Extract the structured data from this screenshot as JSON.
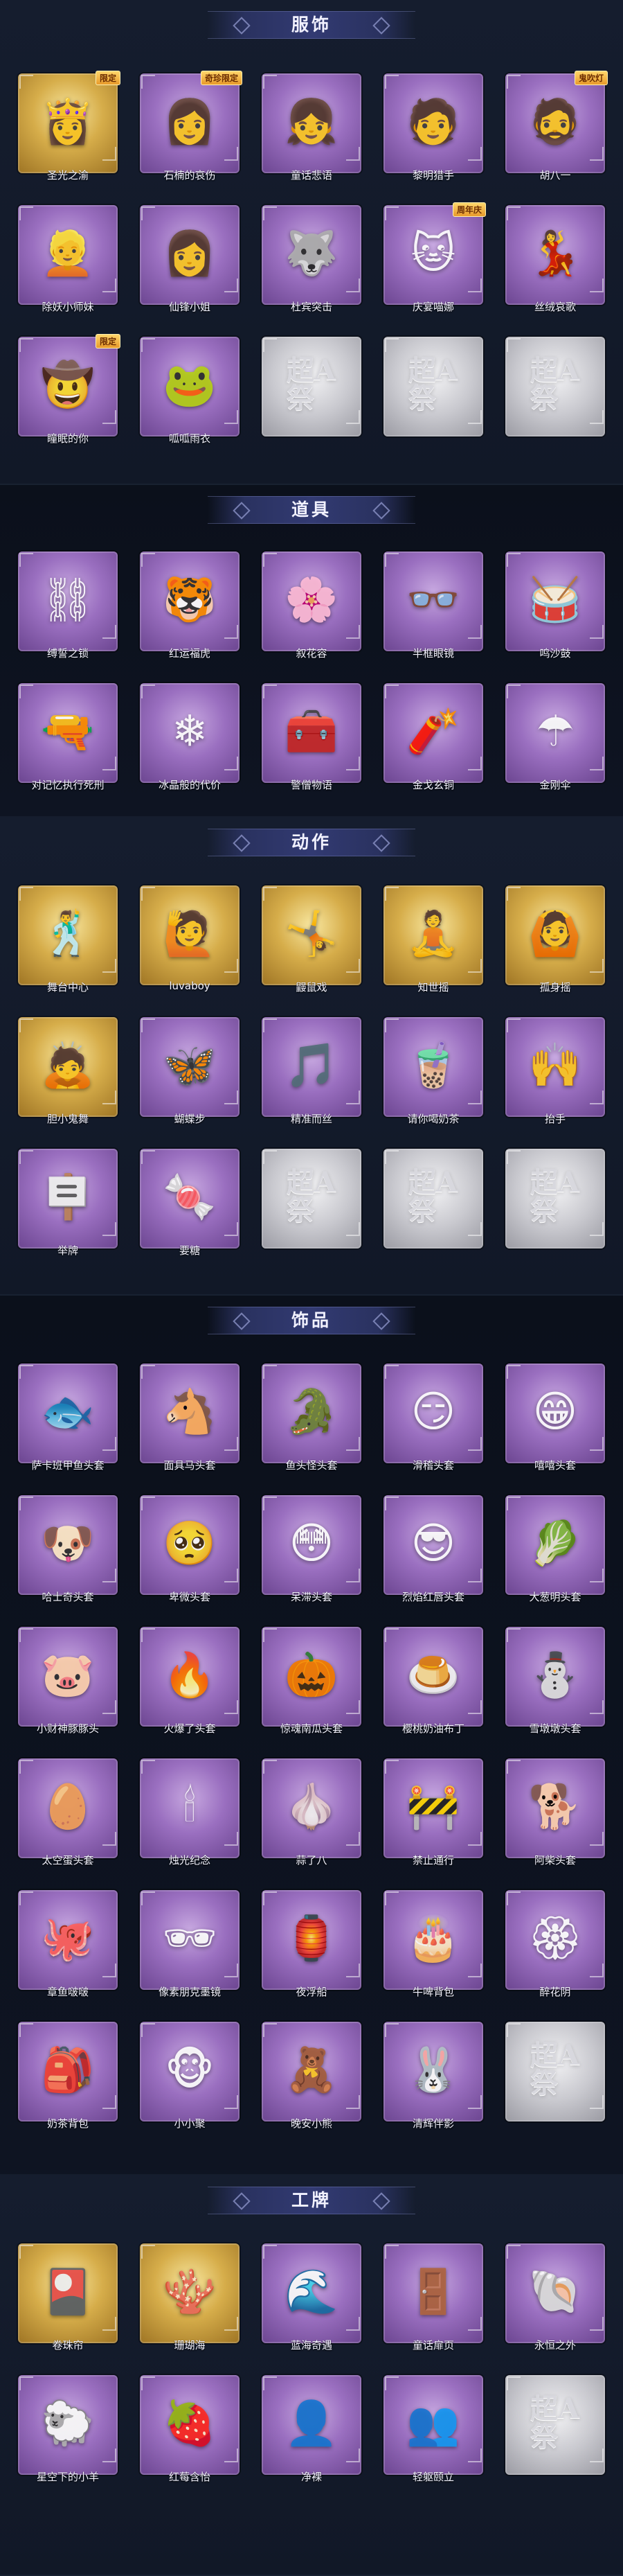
{
  "sections": [
    {
      "title": "服饰",
      "items": [
        {
          "name": "圣光之渝",
          "rarity": "gold",
          "icon": "blonde-girl-portrait",
          "glyph": "👸",
          "badge": "限定"
        },
        {
          "name": "石楠的哀伤",
          "rarity": "purple",
          "icon": "silver-hair-girl-portrait",
          "glyph": "👩",
          "badge": "奇珍限定"
        },
        {
          "name": "童话悲语",
          "rarity": "purple",
          "icon": "red-hair-girl-portrait",
          "glyph": "👧",
          "badge": ""
        },
        {
          "name": "黎明猎手",
          "rarity": "purple",
          "icon": "hunter-portrait",
          "glyph": "🧑",
          "badge": ""
        },
        {
          "name": "胡八一",
          "rarity": "purple",
          "icon": "explorer-portrait",
          "glyph": "🧔",
          "badge": "鬼吹灯"
        },
        {
          "name": "除妖小师妹",
          "rarity": "purple",
          "icon": "exorcist-girl-portrait",
          "glyph": "👱",
          "badge": ""
        },
        {
          "name": "仙锋小姐",
          "rarity": "purple",
          "icon": "lady-portrait",
          "glyph": "👩",
          "badge": ""
        },
        {
          "name": "杜宾突击",
          "rarity": "purple",
          "icon": "doberman-girl-portrait",
          "glyph": "🐺",
          "badge": ""
        },
        {
          "name": "庆宴喵娜",
          "rarity": "purple",
          "icon": "cat-girl-portrait",
          "glyph": "🐱",
          "badge": "周年庆"
        },
        {
          "name": "丝绒哀歌",
          "rarity": "purple",
          "icon": "velvet-girl-portrait",
          "glyph": "💃",
          "badge": ""
        },
        {
          "name": "瞳眠的你",
          "rarity": "purple",
          "icon": "witch-hat-girl-portrait",
          "glyph": "🤠",
          "badge": "限定"
        },
        {
          "name": "呱呱雨衣",
          "rarity": "purple",
          "icon": "frog-raincoat-portrait",
          "glyph": "🐸",
          "badge": ""
        },
        {
          "name": "",
          "rarity": "silver",
          "icon": "placeholder-logo",
          "glyph": "超A祭",
          "badge": ""
        },
        {
          "name": "",
          "rarity": "silver",
          "icon": "placeholder-logo",
          "glyph": "超A祭",
          "badge": ""
        },
        {
          "name": "",
          "rarity": "silver",
          "icon": "placeholder-logo",
          "glyph": "超A祭",
          "badge": ""
        }
      ]
    },
    {
      "title": "道具",
      "items": [
        {
          "name": "缚誓之锁",
          "rarity": "purple",
          "icon": "chain-lock-icon",
          "glyph": "⛓",
          "badge": ""
        },
        {
          "name": "红运福虎",
          "rarity": "purple",
          "icon": "tiger-icon",
          "glyph": "🐯",
          "badge": ""
        },
        {
          "name": "叙花容",
          "rarity": "purple",
          "icon": "flower-vine-icon",
          "glyph": "🌸",
          "badge": ""
        },
        {
          "name": "半框眼镜",
          "rarity": "purple",
          "icon": "glasses-icon",
          "glyph": "👓",
          "badge": ""
        },
        {
          "name": "鸣沙鼓",
          "rarity": "purple",
          "icon": "drum-icon",
          "glyph": "🥁",
          "badge": ""
        },
        {
          "name": "对记忆执行死刑",
          "rarity": "purple",
          "icon": "gun-icon",
          "glyph": "🔫",
          "badge": ""
        },
        {
          "name": "冰晶般的代价",
          "rarity": "purple",
          "icon": "ice-flower-icon",
          "glyph": "❄",
          "badge": ""
        },
        {
          "name": "警僧物语",
          "rarity": "purple",
          "icon": "medkit-icon",
          "glyph": "🧰",
          "badge": ""
        },
        {
          "name": "金戈玄铜",
          "rarity": "purple",
          "icon": "bronze-grenade-icon",
          "glyph": "🧨",
          "badge": ""
        },
        {
          "name": "金刚伞",
          "rarity": "purple",
          "icon": "umbrella-icon",
          "glyph": "☂",
          "badge": ""
        }
      ]
    },
    {
      "title": "动作",
      "items": [
        {
          "name": "舞台中心",
          "rarity": "gold",
          "icon": "pose-figure-icon",
          "glyph": "🕺",
          "badge": ""
        },
        {
          "name": "luvaboy",
          "rarity": "gold",
          "icon": "pose-figure-icon",
          "glyph": "🙋",
          "badge": ""
        },
        {
          "name": "鼹鼠戏",
          "rarity": "gold",
          "icon": "pose-figure-icon",
          "glyph": "🤸",
          "badge": ""
        },
        {
          "name": "知世摇",
          "rarity": "gold",
          "icon": "pose-figure-icon",
          "glyph": "🧘",
          "badge": ""
        },
        {
          "name": "孤身摇",
          "rarity": "gold",
          "icon": "pose-figure-icon",
          "glyph": "🙆",
          "badge": ""
        },
        {
          "name": "胆小鬼舞",
          "rarity": "gold",
          "icon": "pose-figure-icon",
          "glyph": "🙇",
          "badge": ""
        },
        {
          "name": "蝴蝶步",
          "rarity": "purple",
          "icon": "pose-figure-icon",
          "glyph": "🦋",
          "badge": ""
        },
        {
          "name": "精准而丝",
          "rarity": "purple",
          "icon": "pose-figure-icon",
          "glyph": "🎵",
          "badge": ""
        },
        {
          "name": "请你喝奶茶",
          "rarity": "purple",
          "icon": "pose-figure-icon",
          "glyph": "🧋",
          "badge": ""
        },
        {
          "name": "抬手",
          "rarity": "purple",
          "icon": "pose-figure-icon",
          "glyph": "🙌",
          "badge": ""
        },
        {
          "name": "举牌",
          "rarity": "purple",
          "icon": "pose-figure-icon",
          "glyph": "🪧",
          "badge": ""
        },
        {
          "name": "要糖",
          "rarity": "purple",
          "icon": "pose-figure-icon",
          "glyph": "🍬",
          "badge": ""
        },
        {
          "name": "",
          "rarity": "silver",
          "icon": "placeholder-logo",
          "glyph": "超A祭",
          "badge": ""
        },
        {
          "name": "",
          "rarity": "silver",
          "icon": "placeholder-logo",
          "glyph": "超A祭",
          "badge": ""
        },
        {
          "name": "",
          "rarity": "silver",
          "icon": "placeholder-logo",
          "glyph": "超A祭",
          "badge": ""
        }
      ]
    },
    {
      "title": "饰品",
      "items": [
        {
          "name": "萨卡班甲鱼头套",
          "rarity": "purple",
          "icon": "fish-head-icon",
          "glyph": "🐟",
          "badge": ""
        },
        {
          "name": "面具马头套",
          "rarity": "purple",
          "icon": "horse-head-icon",
          "glyph": "🐴",
          "badge": ""
        },
        {
          "name": "鱼头怪头套",
          "rarity": "purple",
          "icon": "fish-monster-icon",
          "glyph": "🐊",
          "badge": ""
        },
        {
          "name": "滑稽头套",
          "rarity": "purple",
          "icon": "smirk-face-icon",
          "glyph": "😏",
          "badge": ""
        },
        {
          "name": "嘻嘻头套",
          "rarity": "purple",
          "icon": "grin-face-icon",
          "glyph": "😁",
          "badge": ""
        },
        {
          "name": "哈士奇头套",
          "rarity": "purple",
          "icon": "husky-icon",
          "glyph": "🐶",
          "badge": ""
        },
        {
          "name": "卑微头套",
          "rarity": "purple",
          "icon": "sad-face-icon",
          "glyph": "🥺",
          "badge": ""
        },
        {
          "name": "呆滞头套",
          "rarity": "purple",
          "icon": "dazed-face-icon",
          "glyph": "😳",
          "badge": ""
        },
        {
          "name": "烈焰红唇头套",
          "rarity": "purple",
          "icon": "pikachu-lips-icon",
          "glyph": "😎",
          "badge": ""
        },
        {
          "name": "大葱明头套",
          "rarity": "purple",
          "icon": "scallion-icon",
          "glyph": "🥬",
          "badge": ""
        },
        {
          "name": "小财神豚豚头",
          "rarity": "purple",
          "icon": "piglet-icon",
          "glyph": "🐷",
          "badge": ""
        },
        {
          "name": "火爆了头套",
          "rarity": "purple",
          "icon": "fire-face-icon",
          "glyph": "🔥",
          "badge": ""
        },
        {
          "name": "惊魂南瓜头套",
          "rarity": "purple",
          "icon": "pumpkin-icon",
          "glyph": "🎃",
          "badge": ""
        },
        {
          "name": "樱桃奶油布丁",
          "rarity": "purple",
          "icon": "pudding-icon",
          "glyph": "🍮",
          "badge": ""
        },
        {
          "name": "雪墩墩头套",
          "rarity": "purple",
          "icon": "snowman-icon",
          "glyph": "⛄",
          "badge": ""
        },
        {
          "name": "太空蛋头套",
          "rarity": "purple",
          "icon": "egg-icon",
          "glyph": "🥚",
          "badge": ""
        },
        {
          "name": "烛光纪念",
          "rarity": "purple",
          "icon": "candle-icon",
          "glyph": "🕯",
          "badge": ""
        },
        {
          "name": "蒜了八",
          "rarity": "purple",
          "icon": "garlic-icon",
          "glyph": "🧄",
          "badge": ""
        },
        {
          "name": "禁止通行",
          "rarity": "purple",
          "icon": "traffic-sign-icon",
          "glyph": "🚧",
          "badge": ""
        },
        {
          "name": "阿柴头套",
          "rarity": "purple",
          "icon": "shiba-icon",
          "glyph": "🐕",
          "badge": ""
        },
        {
          "name": "章鱼啵啵",
          "rarity": "purple",
          "icon": "octopus-icon",
          "glyph": "🐙",
          "badge": ""
        },
        {
          "name": "像素朋克墨镜",
          "rarity": "purple",
          "icon": "pixel-sunglasses-icon",
          "glyph": "🕶",
          "badge": ""
        },
        {
          "name": "夜浮船",
          "rarity": "purple",
          "icon": "lantern-ship-icon",
          "glyph": "🏮",
          "badge": ""
        },
        {
          "name": "牛啤背包",
          "rarity": "purple",
          "icon": "cake-backpack-icon",
          "glyph": "🎂",
          "badge": ""
        },
        {
          "name": "醉花阴",
          "rarity": "purple",
          "icon": "ornament-icon",
          "glyph": "🏵",
          "badge": ""
        },
        {
          "name": "奶茶背包",
          "rarity": "purple",
          "icon": "milk-tea-bag-icon",
          "glyph": "🎒",
          "badge": ""
        },
        {
          "name": "小小聚",
          "rarity": "purple",
          "icon": "monkey-icon",
          "glyph": "🐵",
          "badge": ""
        },
        {
          "name": "晚安小熊",
          "rarity": "purple",
          "icon": "bear-icon",
          "glyph": "🧸",
          "badge": ""
        },
        {
          "name": "清辉伴影",
          "rarity": "purple",
          "icon": "rabbit-spirit-icon",
          "glyph": "🐰",
          "badge": ""
        },
        {
          "name": "",
          "rarity": "silver",
          "icon": "placeholder-logo",
          "glyph": "超A祭",
          "badge": ""
        }
      ]
    },
    {
      "title": "工牌",
      "items": [
        {
          "name": "卷珠帘",
          "rarity": "gold",
          "icon": "badge-card-icon",
          "glyph": "🎴",
          "badge": ""
        },
        {
          "name": "珊瑚海",
          "rarity": "gold",
          "icon": "badge-card-icon",
          "glyph": "🪸",
          "badge": ""
        },
        {
          "name": "蓝海奇遇",
          "rarity": "purple",
          "icon": "badge-card-icon",
          "glyph": "🌊",
          "badge": ""
        },
        {
          "name": "童话扉页",
          "rarity": "purple",
          "icon": "badge-card-icon",
          "glyph": "🚪",
          "badge": ""
        },
        {
          "name": "永恒之外",
          "rarity": "purple",
          "icon": "badge-card-icon",
          "glyph": "🐚",
          "badge": ""
        },
        {
          "name": "星空下的小羊",
          "rarity": "purple",
          "icon": "badge-card-icon",
          "glyph": "🐑",
          "badge": ""
        },
        {
          "name": "红莓含怡",
          "rarity": "purple",
          "icon": "badge-card-icon",
          "glyph": "🍓",
          "badge": ""
        },
        {
          "name": "净裸",
          "rarity": "purple",
          "icon": "badge-card-icon",
          "glyph": "👤",
          "badge": ""
        },
        {
          "name": "轻躯颐立",
          "rarity": "purple",
          "icon": "badge-card-icon",
          "glyph": "👥",
          "badge": ""
        },
        {
          "name": "",
          "rarity": "silver",
          "icon": "placeholder-logo",
          "glyph": "超A祭",
          "badge": ""
        }
      ]
    }
  ]
}
